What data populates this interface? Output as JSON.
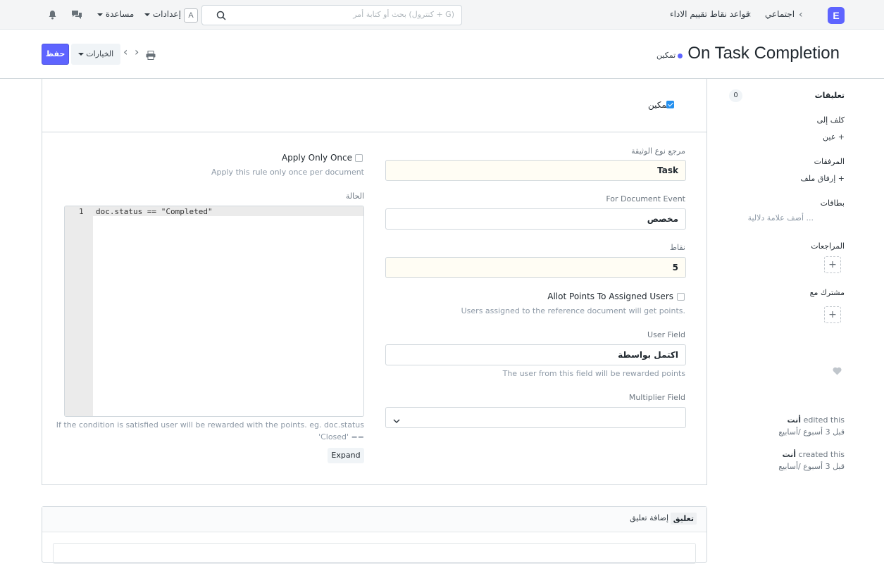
{
  "navbar": {
    "logo": "E",
    "breadcrumbs": [
      "اجتماعي",
      "قواعد نقاط تقييم الاداء"
    ],
    "search_placeholder": "بحث أو كتابة أمر (كنترول + G)",
    "avatar_letter": "A",
    "settings_label": "إعدادات",
    "help_label": "مساعدة"
  },
  "header": {
    "title": "On Task Completion",
    "status": "تمكين",
    "save_label": "حفظ",
    "menu_label": "الخيارات"
  },
  "form": {
    "enabled_label": "تمكين",
    "enabled_checked": true,
    "reference_doctype": {
      "label": "مرجع نوع الوثيقة",
      "value": "Task"
    },
    "document_event": {
      "label": "For Document Event",
      "value": "مخصص"
    },
    "points": {
      "label": "نقاط",
      "value": "5"
    },
    "allot_points": {
      "label": "Allot Points To Assigned Users",
      "help": "Users assigned to the reference document will get points.",
      "checked": false
    },
    "user_field": {
      "label": "User Field",
      "value": "اكتمل بواسطة",
      "help": "The user from this field will be rewarded points"
    },
    "multiplier_field": {
      "label": "Multiplier Field",
      "value": ""
    },
    "apply_once": {
      "label": "Apply Only Once",
      "help": "Apply this rule only once per document",
      "checked": false
    },
    "condition": {
      "label": "الحالة",
      "line_number": "1",
      "code": "doc.status == \"Completed\"",
      "help_line1": "If the condition is satisfied user will be rewarded with the points. eg. doc.status",
      "help_line2": "'Closed' =="
    },
    "expand_label": "Expand"
  },
  "sidebar": {
    "comments_label": "تعليقات",
    "comments_count": "0",
    "assigned_to_label": "كلف إلى",
    "assign_label": "عين",
    "attachments_label": "المرفقات",
    "attach_label": "إرفاق ملف",
    "tags_label": "بطاقات",
    "add_tag_label": "أضف علامة دلالية ...",
    "reviews_label": "المراجعات",
    "shared_label": "مشترك مع",
    "activity": [
      {
        "actor": "أنت",
        "action": "edited this",
        "time": "قبل 3 أسبوع /أسابيع"
      },
      {
        "actor": "أنت",
        "action": "created this",
        "time": "قبل 3 أسبوع /أسابيع"
      }
    ]
  },
  "comments": {
    "tab_comment": "تعليق",
    "tab_add_comment": "إضافة تعليق"
  }
}
